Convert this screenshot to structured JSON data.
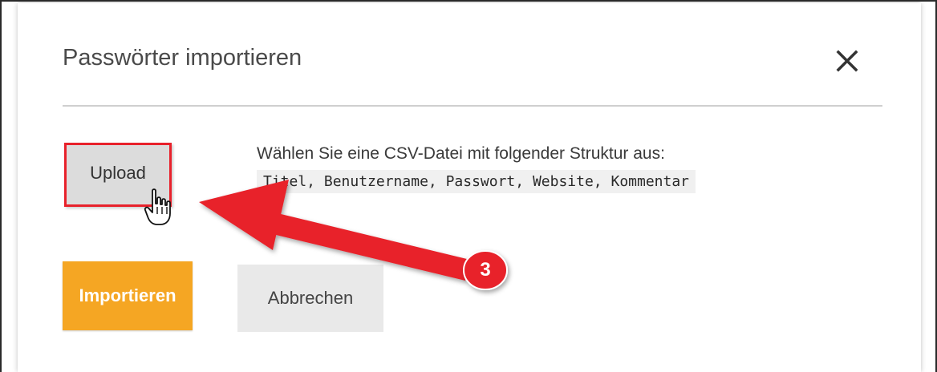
{
  "dialog": {
    "title": "Passwörter importieren",
    "close_icon": "close-icon"
  },
  "upload": {
    "label": "Upload"
  },
  "instructions": {
    "description": "Wählen Sie eine CSV-Datei mit folgender Struktur aus:",
    "structure": "Titel, Benutzername, Passwort, Website, Kommentar"
  },
  "actions": {
    "import_label": "Importieren",
    "cancel_label": "Abbrechen"
  },
  "annotation": {
    "step_number": "3",
    "highlight_color": "#e8212b",
    "arrow_color": "#e8212b"
  },
  "colors": {
    "primary": "#f5a623",
    "secondary_button": "#e9e9e9",
    "upload_button": "#dcdcdc"
  },
  "icons": {
    "cursor": "hand-pointer-icon"
  }
}
